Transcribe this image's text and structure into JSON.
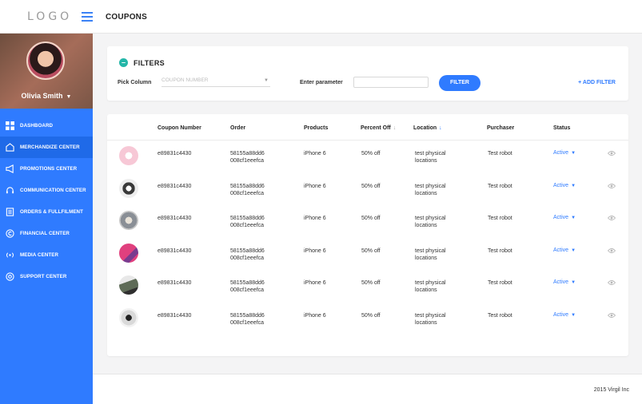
{
  "header": {
    "logo": "LOGO",
    "title": "COUPONS"
  },
  "profile": {
    "name": "Olivia Smith"
  },
  "sidebar": {
    "items": [
      {
        "label": "Dashboard",
        "icon": "grid-icon"
      },
      {
        "label": "Merchandize Center",
        "icon": "store-icon"
      },
      {
        "label": "Promotions Center",
        "icon": "megaphone-icon"
      },
      {
        "label": "Communication Center",
        "icon": "headset-icon"
      },
      {
        "label": "Orders & Fullfilment",
        "icon": "orders-icon"
      },
      {
        "label": "Financial Center",
        "icon": "copyright-icon"
      },
      {
        "label": "Media Center",
        "icon": "broadcast-icon"
      },
      {
        "label": "Support Center",
        "icon": "support-icon"
      }
    ]
  },
  "filters": {
    "title": "FILTERS",
    "pick_column_label": "Pick Column",
    "pick_column_value": "COUPON NUMBER",
    "enter_parameter_label": "Enter parameter",
    "parameter_value": "",
    "filter_button": "FILTER",
    "add_filter": "+ ADD FILTER"
  },
  "table": {
    "columns": [
      "Coupon Number",
      "Order",
      "Products",
      "Percent Off",
      "Location",
      "Purchaser",
      "Status"
    ],
    "rows": [
      {
        "coupon": "e89831c4430",
        "order1": "58155a88dd6",
        "order2": "008cf1eeefca",
        "product": "iPhone 6",
        "percent": "50% off",
        "loc1": "test physical",
        "loc2": "locations",
        "purchaser": "Test robot",
        "status": "Active",
        "thumb": "#f7c8d6"
      },
      {
        "coupon": "e89831c4430",
        "order1": "58155a88dd6",
        "order2": "008cf1eeefca",
        "product": "iPhone 6",
        "percent": "50% off",
        "loc1": "test physical",
        "loc2": "locations",
        "purchaser": "Test robot",
        "status": "Active",
        "thumb": "#3a3a3a"
      },
      {
        "coupon": "e89831c4430",
        "order1": "58155a88dd6",
        "order2": "008cf1eeefca",
        "product": "iPhone 6",
        "percent": "50% off",
        "loc1": "test physical",
        "loc2": "locations",
        "purchaser": "Test robot",
        "status": "Active",
        "thumb": "#8a8f96"
      },
      {
        "coupon": "e89831c4430",
        "order1": "58155a88dd6",
        "order2": "008cf1eeefca",
        "product": "iPhone 6",
        "percent": "50% off",
        "loc1": "test physical",
        "loc2": "locations",
        "purchaser": "Test robot",
        "status": "Active",
        "thumb": "#e0407e"
      },
      {
        "coupon": "e89831c4430",
        "order1": "58155a88dd6",
        "order2": "008cf1eeefca",
        "product": "iPhone 6",
        "percent": "50% off",
        "loc1": "test physical",
        "loc2": "locations",
        "purchaser": "Test robot",
        "status": "Active",
        "thumb": "#5e6b57"
      },
      {
        "coupon": "e89831c4430",
        "order1": "58155a88dd6",
        "order2": "008cf1eeefca",
        "product": "iPhone 6",
        "percent": "50% off",
        "loc1": "test physical",
        "loc2": "locations",
        "purchaser": "Test robot",
        "status": "Active",
        "thumb": "#d9d9d9"
      }
    ]
  },
  "footer": {
    "copyright": "2015 Virgil Inc"
  },
  "colors": {
    "accent": "#2f7bff",
    "sidebar": "#2f7bff",
    "filter_icon": "#23b6a8"
  }
}
